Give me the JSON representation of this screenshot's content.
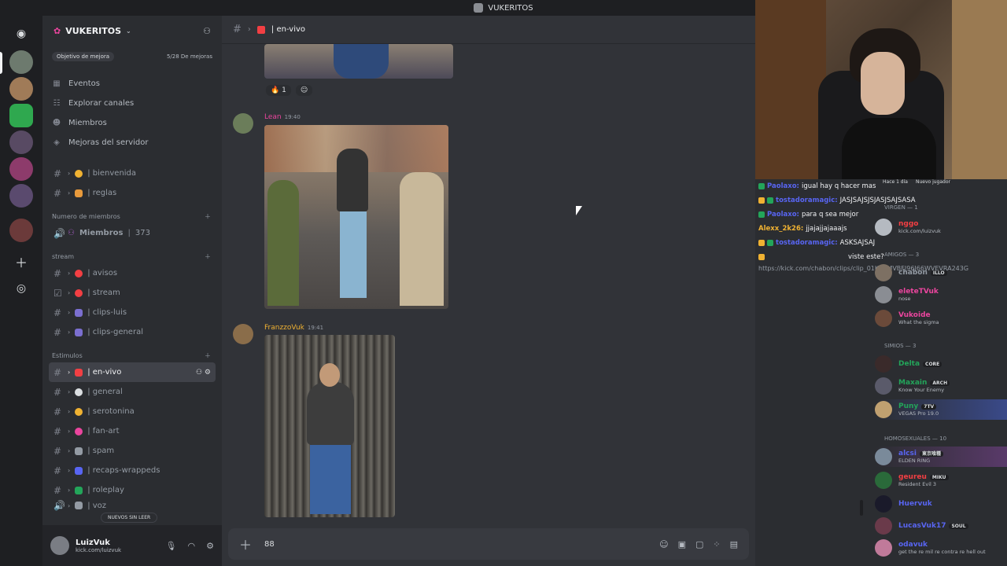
{
  "window": {
    "title": "VUKERITOS"
  },
  "server": {
    "name": "VUKERITOS",
    "boost": {
      "label": "Objetivo de mejora",
      "progress": "5/28 De mejoras"
    }
  },
  "nav": [
    {
      "label": "Eventos",
      "icon": "calendar-icon"
    },
    {
      "label": "Explorar canales",
      "icon": "compass-icon"
    },
    {
      "label": "Miembros",
      "icon": "members-icon"
    },
    {
      "label": "Mejoras del servidor",
      "icon": "boost-icon"
    }
  ],
  "channels_top": [
    {
      "label": "| bienvenida"
    },
    {
      "label": "| reglas"
    }
  ],
  "categories": {
    "member_count": "Numero de miembros",
    "stream": "stream",
    "estimulos": "Estimulos"
  },
  "member_stat": {
    "label": "Miembros",
    "count": "373"
  },
  "stream_channels": [
    {
      "label": "| avisos"
    },
    {
      "label": "| stream"
    },
    {
      "label": "| clips-luis"
    },
    {
      "label": "| clips-general"
    }
  ],
  "estimulo_channels": [
    {
      "label": "| en-vivo",
      "active": true
    },
    {
      "label": "| general"
    },
    {
      "label": "| serotonina"
    },
    {
      "label": "| fan-art"
    },
    {
      "label": "| spam"
    },
    {
      "label": "| recaps-wrappeds"
    },
    {
      "label": "| roleplay"
    },
    {
      "label": "| voz"
    }
  ],
  "unread_pill": "NUEVOS SIN LEER",
  "user": {
    "name": "LuizVuk",
    "status": "kick.com/luizvuk"
  },
  "channel_header": {
    "name": "| en-vivo"
  },
  "messages": [
    {
      "author": "Lean",
      "time": "19:40",
      "color": "#eb459e"
    },
    {
      "author": "FranzzoVuk",
      "time": "19:41",
      "color": "#f0b232"
    }
  ],
  "reactions_top": [
    {
      "emoji": "🔥",
      "count": "1"
    }
  ],
  "composer": {
    "value": "88"
  },
  "chat": [
    {
      "nick": "Paolaxo:",
      "text": "igual hay q hacer mas",
      "nick_color": "#5865f2"
    },
    {
      "nick": "tostadoramagic:",
      "text": "JASJSAJSJSJASJSAJSASA",
      "nick_color": "#5865f2"
    },
    {
      "nick": "Paolaxo:",
      "text": "para q sea mejor",
      "nick_color": "#5865f2"
    },
    {
      "nick": "Alexx_2k26:",
      "text": "jjajajjajaaajs",
      "nick_color": "#f0b232"
    },
    {
      "nick": "tostadoramagic:",
      "text": "ASKSAJSAJ",
      "nick_color": "#5865f2"
    },
    {
      "nick": "",
      "text": "viste este?",
      "nick_color": "#949ba4"
    }
  ],
  "chat_link": "https://kick.com/chabon/clips/clip_01KEKMVBFJ96J66WVEVRA243G",
  "cam_meta": {
    "time": "Hace 1 día",
    "label": "Nuevo jugador"
  },
  "member_groups": {
    "virgen": "VIRGEN — 1",
    "amigos": "AMIGOS — 3",
    "simios": "SIMIOS — 3",
    "homo": "HOMOSEXUALES — 10"
  },
  "members": [
    {
      "name": "nggo",
      "sub": "kick.com/luizvuk",
      "color": "#f23f43",
      "tag": ""
    },
    {
      "name": "chabon",
      "sub": "",
      "color": "#949ba4",
      "tag": "ILLO"
    },
    {
      "name": "eleteTVuk",
      "sub": "nose",
      "color": "#eb459e",
      "tag": ""
    },
    {
      "name": "Vukoide",
      "sub": "What the sigma",
      "color": "#eb459e",
      "tag": ""
    },
    {
      "name": "Delta",
      "sub": "",
      "color": "#23a55a",
      "tag": "CORE"
    },
    {
      "name": "Maxain",
      "sub": "Know Your Enemy",
      "color": "#23a55a",
      "tag": "ARCH"
    },
    {
      "name": "Puny",
      "sub": "VEGAS Pro 19.0",
      "color": "#23a55a",
      "tag": "7TV"
    },
    {
      "name": "alcsi",
      "sub": "ELDEN RING",
      "color": "#5865f2",
      "tag": "東京喰種"
    },
    {
      "name": "geureu",
      "sub": "Resident Evil 3",
      "color": "#f23f43",
      "tag": "MIKU"
    },
    {
      "name": "Huervuk",
      "sub": "",
      "color": "#5865f2",
      "tag": ""
    },
    {
      "name": "LucasVuk17",
      "sub": "",
      "color": "#5865f2",
      "tag": "SOUL"
    },
    {
      "name": "odavuk",
      "sub": "get the re mil re contra re hell out",
      "color": "#5865f2",
      "tag": ""
    }
  ],
  "colors": {
    "bg": "#1e1f22",
    "sidebar": "#2b2d31",
    "main": "#313338",
    "accent": "#5865f2"
  }
}
